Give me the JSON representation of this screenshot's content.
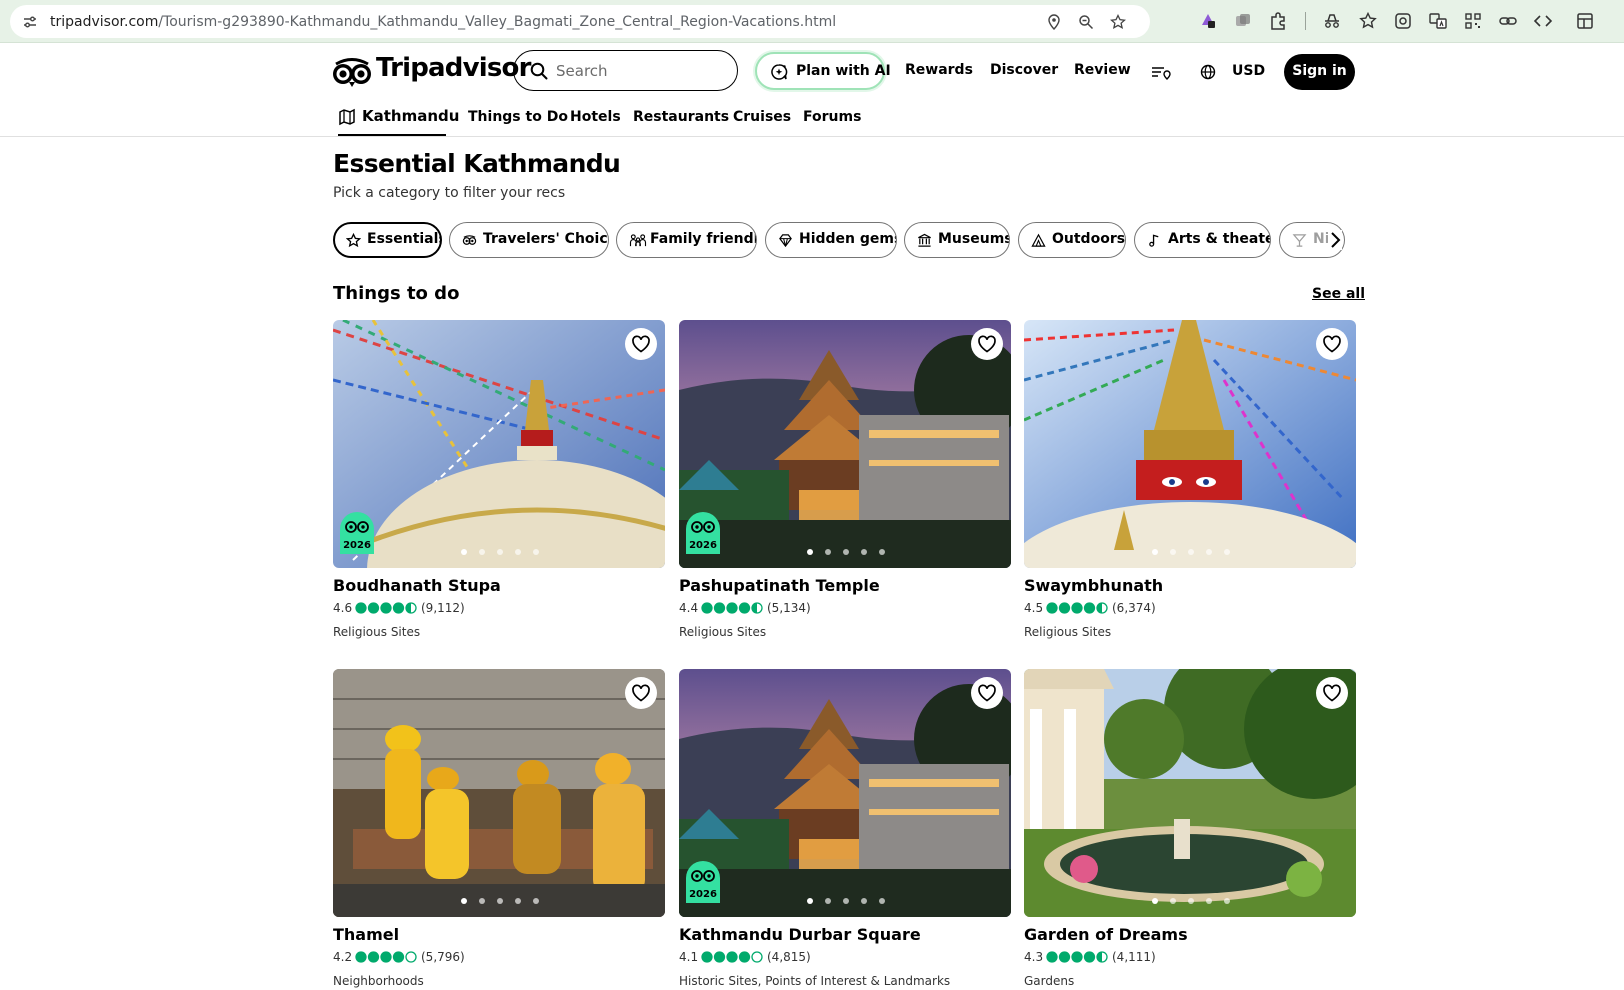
{
  "browser": {
    "url_host": "tripadvisor.com",
    "url_path": "/Tourism-g293890-Kathmandu_Kathmandu_Valley_Bagmati_Zone_Central_Region-Vacations.html"
  },
  "header": {
    "logo_text": "Tripadvisor",
    "search_placeholder": "Search",
    "plan_ai_label": "Plan with AI",
    "nav": [
      "Rewards",
      "Discover",
      "Review"
    ],
    "currency": "USD",
    "sign_in_label": "Sign in"
  },
  "subnav": {
    "active": "Kathmandu",
    "links": [
      "Things to Do",
      "Hotels",
      "Restaurants",
      "Cruises",
      "Forums"
    ]
  },
  "page": {
    "title": "Essential Kathmandu",
    "subtitle": "Pick a category to filter your recs"
  },
  "chips": [
    {
      "label": "Essentials",
      "icon": "star-icon",
      "active": true
    },
    {
      "label": "Travelers' Choice",
      "icon": "owl-icon",
      "active": false
    },
    {
      "label": "Family friendly",
      "icon": "family-icon",
      "active": false
    },
    {
      "label": "Hidden gems",
      "icon": "gem-icon",
      "active": false
    },
    {
      "label": "Museums",
      "icon": "museum-icon",
      "active": false
    },
    {
      "label": "Outdoors",
      "icon": "tent-icon",
      "active": false
    },
    {
      "label": "Arts & theater",
      "icon": "music-note-icon",
      "active": false
    },
    {
      "label": "Nig",
      "icon": "glass-icon",
      "active": false
    }
  ],
  "section": {
    "title": "Things to do",
    "see_all_label": "See all"
  },
  "cards": [
    {
      "name": "Boudhanath Stupa",
      "rating": "4.6",
      "reviews": "(9,112)",
      "category": "Religious Sites",
      "bubbles": 4.5,
      "award": "2026"
    },
    {
      "name": "Pashupatinath Temple",
      "rating": "4.4",
      "reviews": "(5,134)",
      "category": "Religious Sites",
      "bubbles": 4.5,
      "award": "2026"
    },
    {
      "name": "Swaymbhunath",
      "rating": "4.5",
      "reviews": "(6,374)",
      "category": "Religious Sites",
      "bubbles": 4.5,
      "award": ""
    },
    {
      "name": "Thamel",
      "rating": "4.2",
      "reviews": "(5,796)",
      "category": "Neighborhoods",
      "bubbles": 4,
      "award": ""
    },
    {
      "name": "Kathmandu Durbar Square",
      "rating": "4.1",
      "reviews": "(4,815)",
      "category": "Historic Sites, Points of Interest & Landmarks",
      "bubbles": 4,
      "award": "2026"
    },
    {
      "name": "Garden of Dreams",
      "rating": "4.3",
      "reviews": "(4,111)",
      "category": "Gardens",
      "bubbles": 4.5,
      "award": ""
    }
  ],
  "colors": {
    "brand_green": "#00aa6c",
    "bubble_green": "#00aa6c",
    "browser_bar": "#e7f2e7",
    "text": "#000000"
  }
}
